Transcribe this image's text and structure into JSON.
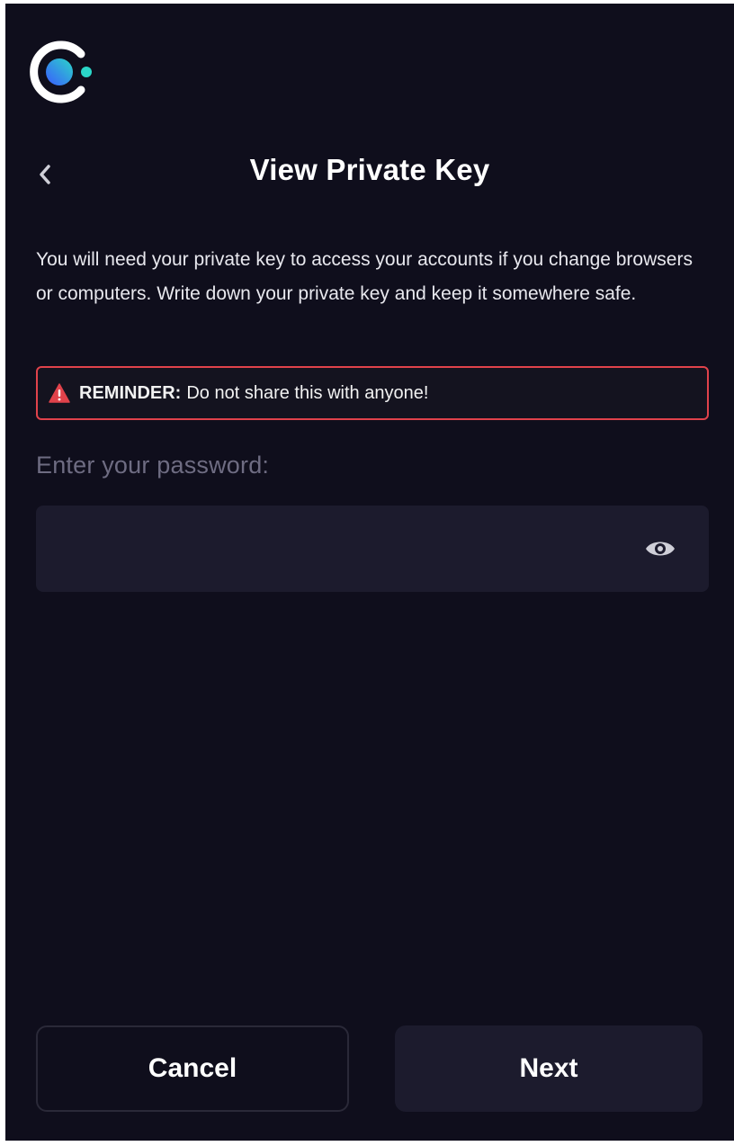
{
  "header": {
    "logo_icon": "app-logo-icon",
    "back_icon": "chevron-left-icon",
    "title": "View Private Key"
  },
  "description": "You will need your private key to access your accounts if you change browsers or computers. Write down your private key and keep it somewhere safe.",
  "reminder": {
    "icon": "warning-triangle-icon",
    "label": "REMINDER:",
    "text": "Do not share this with anyone!",
    "border_color": "#e0424b"
  },
  "password": {
    "label": "Enter your password:",
    "value": "",
    "placeholder": "",
    "toggle_icon": "eye-icon"
  },
  "actions": {
    "cancel_label": "Cancel",
    "next_label": "Next"
  },
  "colors": {
    "background": "#0f0e1c",
    "field_background": "#1c1b2d",
    "accent_gradient_start": "#2bd6c8",
    "accent_gradient_end": "#3a5bff"
  }
}
